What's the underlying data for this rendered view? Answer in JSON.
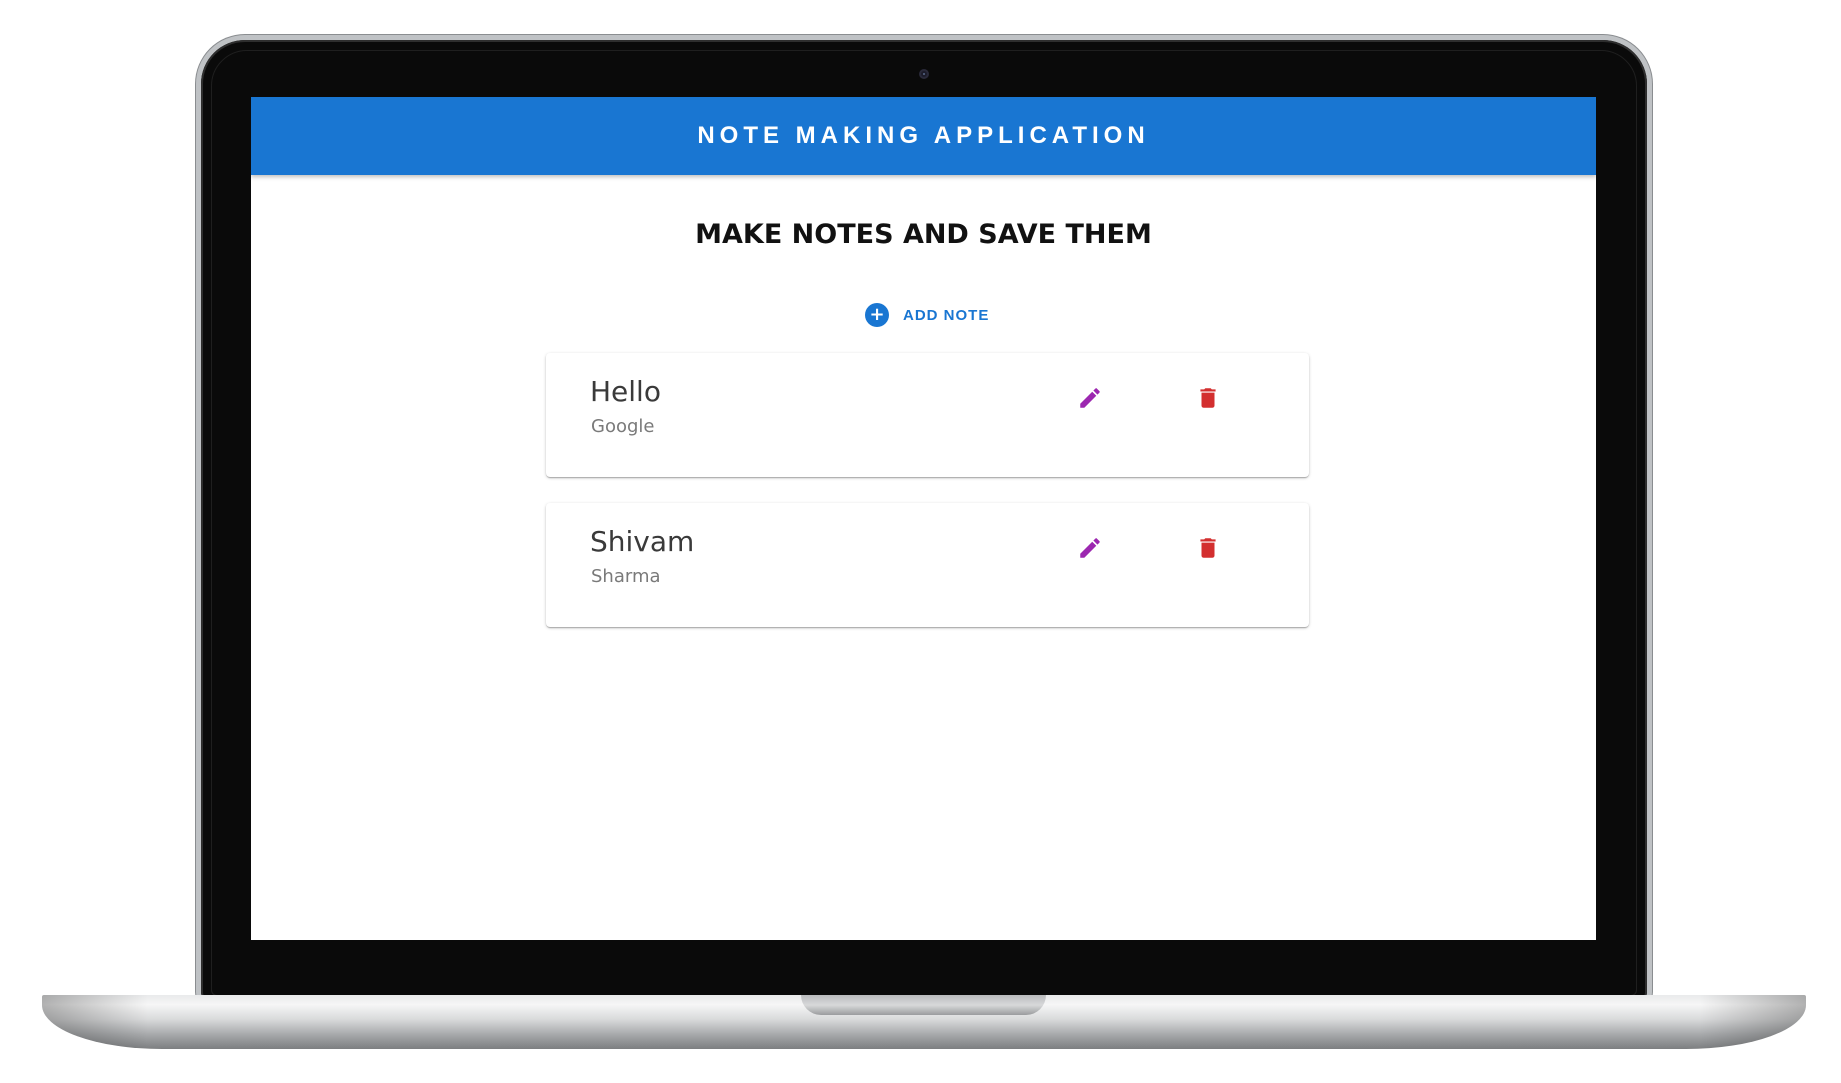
{
  "app": {
    "title": "NOTE MAKING APPLICATION"
  },
  "main": {
    "heading": "MAKE NOTES AND SAVE THEM",
    "add_note_label": "ADD NOTE",
    "notes": [
      {
        "title": "Hello",
        "content": "Google"
      },
      {
        "title": "Shivam",
        "content": "Sharma"
      }
    ]
  },
  "icons": {
    "add": "add-circle-icon",
    "edit": "pencil-icon",
    "delete": "trash-icon"
  },
  "colors": {
    "primary": "#1976d2",
    "edit": "#9c27b0",
    "delete": "#d32f2f"
  }
}
